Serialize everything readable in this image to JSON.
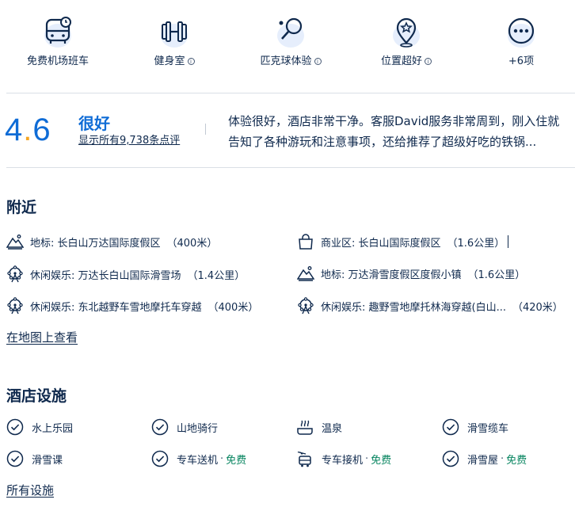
{
  "highlights": [
    {
      "label": "免费机场班车",
      "icon": "shuttle-bus-icon",
      "info": false
    },
    {
      "label": "健身室",
      "icon": "dumbbell-icon",
      "info": true
    },
    {
      "label": "匹克球体验",
      "icon": "paddle-ball-icon",
      "info": true
    },
    {
      "label": "位置超好",
      "icon": "location-star-icon",
      "info": true
    },
    {
      "label": "+6项",
      "icon": "more-icon",
      "info": false
    }
  ],
  "info_glyph": "i",
  "rating": {
    "score_int": "4",
    "score_dot": ".",
    "score_dec": "6",
    "word": "很好",
    "reviews_link": "显示所有9,738条点评",
    "quote": "体验很好，酒店非常干净。客服David服务非常周到，刚入住就告知了各种游玩和注意事项，还给推荐了超级好吃的铁锅..."
  },
  "nearby": {
    "title": "附近",
    "items": [
      {
        "text": "地标: 长白山万达国际度假区",
        "distance": "（400米）",
        "icon": "mountain-icon"
      },
      {
        "text": "商业区: 长白山国际度假区",
        "distance": "（1.6公里）",
        "icon": "shopping-bag-icon"
      },
      {
        "text": "休闲娱乐: 万达长白山国际滑雪场",
        "distance": "（1.4公里）",
        "icon": "ferris-wheel-icon"
      },
      {
        "text": "地标: 万达滑雪度假区度假小镇",
        "distance": "（1.6公里）",
        "icon": "mountain-icon"
      },
      {
        "text": "休闲娱乐: 东北越野车雪地摩托车穿越",
        "distance": "（400米）",
        "icon": "ferris-wheel-icon"
      },
      {
        "text": "休闲娱乐: 趣野雪地摩托林海穿越(白山...",
        "distance": "（420米）",
        "icon": "ferris-wheel-icon"
      }
    ],
    "map_link": "在地图上查看"
  },
  "facilities": {
    "title": "酒店设施",
    "items": [
      {
        "label": "水上乐园",
        "icon": "check-circle-icon",
        "suffix": "",
        "free": ""
      },
      {
        "label": "山地骑行",
        "icon": "check-circle-icon",
        "suffix": "",
        "free": ""
      },
      {
        "label": "温泉",
        "icon": "hot-spring-icon",
        "suffix": "",
        "free": ""
      },
      {
        "label": "滑雪缆车",
        "icon": "check-circle-icon",
        "suffix": "",
        "free": ""
      },
      {
        "label": "滑雪课",
        "icon": "check-circle-icon",
        "suffix": "",
        "free": ""
      },
      {
        "label": "专车送机",
        "icon": "check-circle-icon",
        "suffix": "·",
        "free": "免费"
      },
      {
        "label": "专车接机",
        "icon": "airport-shuttle-icon",
        "suffix": "·",
        "free": "免费"
      },
      {
        "label": "滑雪屋",
        "icon": "check-circle-icon",
        "suffix": "·",
        "free": "免费"
      }
    ],
    "all_link": "所有设施"
  },
  "colors": {
    "primary_text": "#0f294d",
    "accent_blue": "#0f6cd6",
    "score_dot": "#f5a623",
    "free_green": "#06845f",
    "divider": "#dadfe6"
  }
}
